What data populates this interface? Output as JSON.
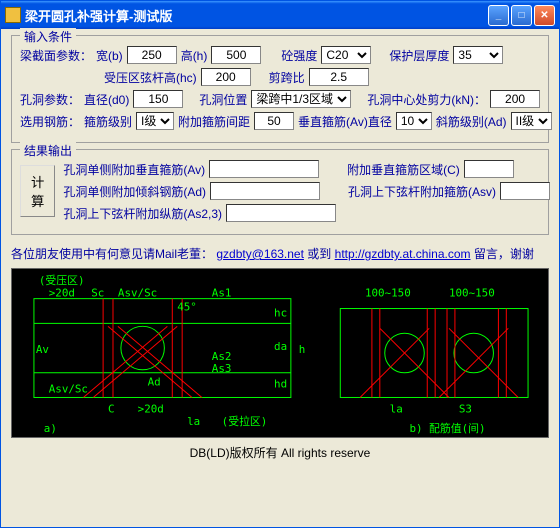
{
  "window": {
    "title": "梁开圆孔补强计算-测试版"
  },
  "input_section": {
    "legend": "输入条件",
    "beam_params_label": "梁截面参数：",
    "width_label": "宽(b)",
    "width_value": "250",
    "height_label": "高(h)",
    "height_value": "500",
    "concrete_label": "砼强度",
    "concrete_value": "C20",
    "cover_label": "保护层厚度",
    "cover_value": "35",
    "hc_label": "受压区弦杆高(hc)",
    "hc_value": "200",
    "shear_span_label": "剪跨比",
    "shear_span_value": "2.5",
    "hole_params_label": "孔洞参数：",
    "diameter_label": "直径(d0)",
    "diameter_value": "150",
    "hole_pos_label": "孔洞位置",
    "hole_pos_value": "梁跨中1/3区域",
    "shear_force_label": "孔洞中心处剪力(kN)：",
    "shear_force_value": "200",
    "rebar_select_label": "选用钢筋：",
    "stirrup_class_label": "箍筋级别",
    "stirrup_class_value": "I级",
    "add_stirrup_label": "附加箍筋间距",
    "add_stirrup_value": "50",
    "vert_stirrup_label": "垂直箍筋(Av)直径",
    "vert_stirrup_value": "10",
    "diag_class_label": "斜筋级别(Ad)",
    "diag_class_value": "II级"
  },
  "output_section": {
    "legend": "结果输出",
    "calc_button": "计 算",
    "av_label": "孔洞单侧附加垂直箍筋(Av)",
    "ad_label": "孔洞单侧附加倾斜钢筋(Ad)",
    "as23_label": "孔洞上下弦杆附加纵筋(As2,3)",
    "c_label": "附加垂直箍筋区域(C)",
    "asv_label": "孔洞上下弦杆附加箍筋(Asv)"
  },
  "message": {
    "prefix": "各位朋友使用中有何意见请Mail老董：",
    "email": "gzdbty@163.net",
    "mid": " 或到",
    "url": "http://gzdbty.at.china.com",
    "suffix": "留言，谢谢"
  },
  "diagram_labels": {
    "compress": "(受压区)",
    "gt20d": ">20d",
    "sc": "Sc",
    "asv_sc": "Asv/Sc",
    "angle45": "45°",
    "as1": "As1",
    "as2": "As2",
    "as3": "As3",
    "av": "Av",
    "ad": "Ad",
    "c": "C",
    "la": "la",
    "hc": "hc",
    "da": "da",
    "hd": "hd",
    "h": "h",
    "tension": "(受拉区)",
    "a_label": "a)",
    "range1": "100~150",
    "s3": "S3",
    "b_label": "b) 配筋值(间)"
  },
  "footer": "DB(LD)版权所有  All rights reserve"
}
